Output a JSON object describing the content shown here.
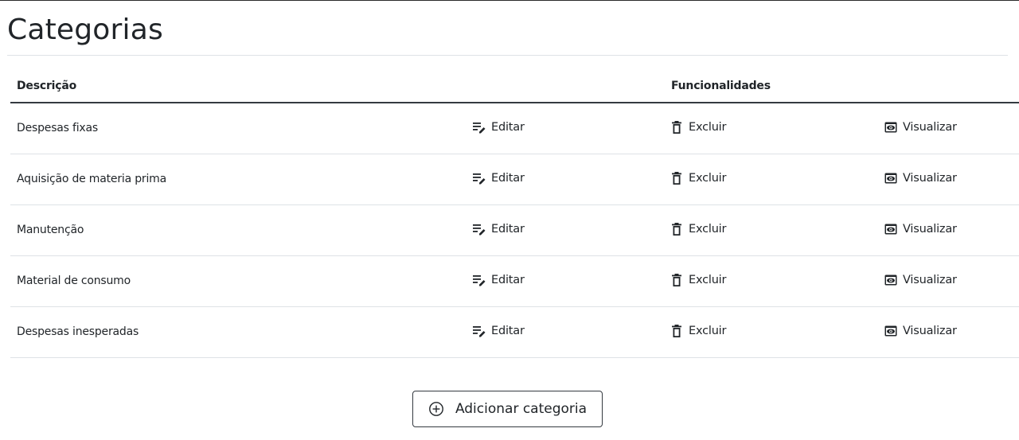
{
  "page": {
    "title": "Categorias"
  },
  "table": {
    "headers": {
      "description": "Descrição",
      "features": "Funcionalidades"
    },
    "actions": {
      "edit_label": "Editar",
      "delete_label": "Excluir",
      "view_label": "Visualizar",
      "edit_icon": "edit-note-icon",
      "delete_icon": "trash-icon",
      "view_icon": "eye-icon"
    },
    "rows": [
      {
        "description": "Despesas fixas"
      },
      {
        "description": "Aquisição de materia prima"
      },
      {
        "description": "Manutenção"
      },
      {
        "description": "Material de consumo"
      },
      {
        "description": "Despesas inesperadas"
      }
    ]
  },
  "add_button": {
    "label": "Adicionar categoria",
    "icon": "plus-circle-icon"
  },
  "colors": {
    "text": "#212529",
    "border_dark": "#343a40",
    "border_light": "#dee2e6",
    "background": "#ffffff"
  }
}
